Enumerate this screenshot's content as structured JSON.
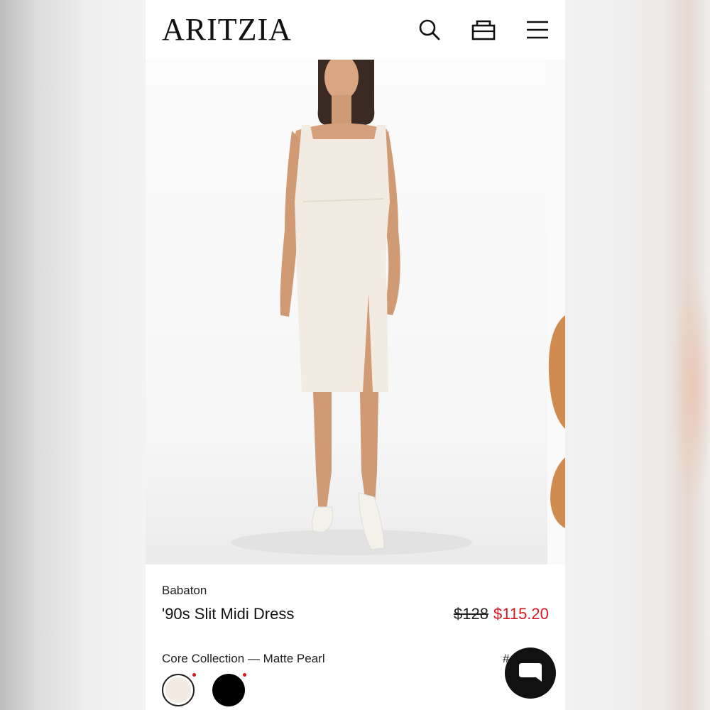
{
  "header": {
    "logo": "ARITZIA",
    "icons": [
      "search-icon",
      "shopping-bag-icon",
      "menu-icon"
    ]
  },
  "product": {
    "brand": "Babaton",
    "name": "'90s Slit Midi Dress",
    "price_original": "$128",
    "price_sale": "$115.20",
    "color_label": "Core Collection — Matte Pearl",
    "swatch_count_partial": "#",
    "swatches": [
      {
        "name": "Matte Pearl",
        "color": "#f1ebe3",
        "selected": true
      },
      {
        "name": "Black",
        "color": "#000000",
        "selected": false
      }
    ]
  },
  "colors": {
    "sale": "#d6191e",
    "text": "#111111",
    "chat_button": "#111111"
  },
  "chat": {
    "icon": "chat-bubble-icon"
  }
}
